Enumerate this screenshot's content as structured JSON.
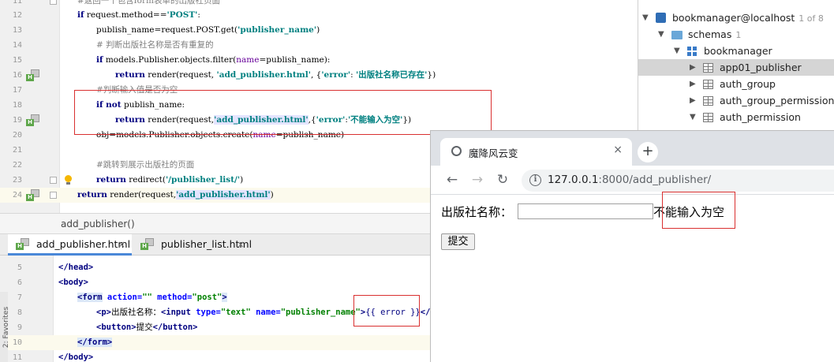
{
  "python_editor": {
    "lines": [
      {
        "num": "11",
        "comment": "#返回一个包含form表单的出版社页面"
      },
      {
        "num": "12",
        "kw": "if",
        "rest": " request.method==",
        "str": "'POST'",
        "tail": ":"
      },
      {
        "num": "13",
        "pre": "publish_name=request.POST.get(",
        "str": "'publisher_name'",
        "tail": ")"
      },
      {
        "num": "14",
        "comment": "# 判断出版社名称是否有重复的"
      },
      {
        "num": "15",
        "kw": "if",
        "pre": " models.Publisher.objects.filter(",
        "kwarg": "name",
        "mid": "=publish_name):"
      },
      {
        "num": "16",
        "kw": "return",
        "pre": " render(request, ",
        "str": "'add_publisher.html'",
        "mid": ", {",
        "str2": "'error'",
        "mid2": ": ",
        "str3": "'出版社名称已存在'",
        "tail": "})"
      },
      {
        "num": "17",
        "comment": "#判断输入值是否为空"
      },
      {
        "num": "18",
        "kw": "if not",
        "rest": " publish_name:"
      },
      {
        "num": "19",
        "kw": "return",
        "pre": " render(request,",
        "str": "'add_publisher.html'",
        "mid": ",{",
        "str2": "'error'",
        "mid2": ":",
        "str3": "'不能输入为空'",
        "tail": "})"
      },
      {
        "num": "20",
        "pre": "obj=models.Publisher.objects.create(",
        "kwarg": "name",
        "mid": "=publish_name)"
      },
      {
        "num": "21"
      },
      {
        "num": "22",
        "comment": "#跳转到展示出版社的页面"
      },
      {
        "num": "23",
        "kw": "return",
        "pre": " redirect(",
        "str": "'/publisher_list/'",
        "tail": ")"
      },
      {
        "num": "24",
        "kw": "return",
        "pre": " render(request,",
        "str": "'add_publisher.html'",
        "tail": ")"
      }
    ],
    "breadcrumb": "add_publisher()"
  },
  "editor_tabs": [
    {
      "label": "add_publisher.html",
      "close": "×"
    },
    {
      "label": "publisher_list.html",
      "close": "×"
    }
  ],
  "html_editor": {
    "favorites": "2: Favorites",
    "lines": [
      {
        "num": "5",
        "text": "</head>"
      },
      {
        "num": "6",
        "text": "<body>"
      },
      {
        "num": "7",
        "t1": "<form",
        "a1": " action=",
        "v1": "\"\"",
        "a2": " method=",
        "v2": "\"post\"",
        "t2": ">"
      },
      {
        "num": "8",
        "t1": "<p>",
        "plain": "出版社名称：",
        "t2": "<input",
        "a1": " type=",
        "v1": "\"text\"",
        "a2": " name=",
        "v2": "\"publisher_name\"",
        "t3": ">",
        "tpl": "{{ error }}",
        "t4": "</p>"
      },
      {
        "num": "9",
        "t1": "<button>",
        "plain": "提交",
        "t2": "</button>"
      },
      {
        "num": "10",
        "text": "</form>"
      },
      {
        "num": "11",
        "text": "</body>"
      }
    ]
  },
  "db_tree": [
    {
      "label": "bookmanager@localhost",
      "count": "1 of 8"
    },
    {
      "label": "schemas",
      "count": "1"
    },
    {
      "label": "bookmanager"
    },
    {
      "label": "app01_publisher"
    },
    {
      "label": "auth_group"
    },
    {
      "label": "auth_group_permissions"
    },
    {
      "label": "auth_permission"
    }
  ],
  "browser": {
    "tab_title": "魔降风云变",
    "tab_close": "×",
    "new_tab": "+",
    "back": "←",
    "forward": "→",
    "reload": "↻",
    "info": "i",
    "url_host": "127.0.0.1",
    "url_path": ":8000/add_publisher/",
    "form_label": "出版社名称：",
    "input_value": "",
    "error_text": "不能输入为空",
    "submit_label": "提交"
  }
}
